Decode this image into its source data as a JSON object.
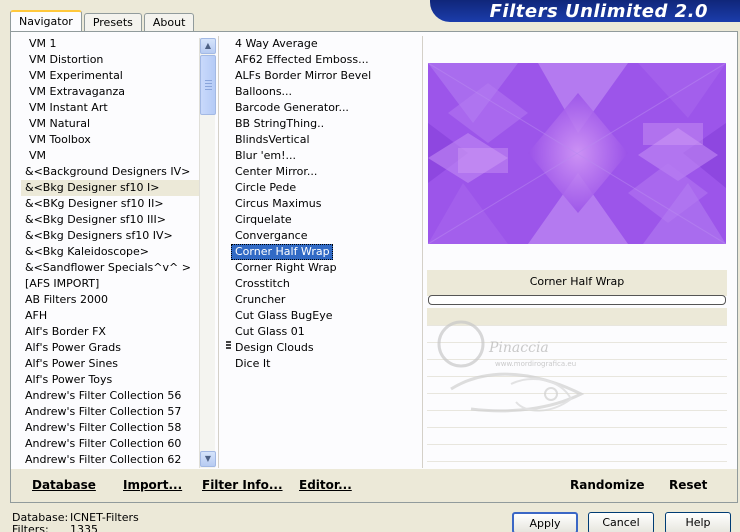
{
  "tabs": [
    "Navigator",
    "Presets",
    "About"
  ],
  "app_title": "Filters Unlimited 2.0",
  "categories": [
    "VM 1",
    "VM Distortion",
    "VM Experimental",
    "VM Extravaganza",
    "VM Instant Art",
    "VM Natural",
    "VM Toolbox",
    "VM",
    "&<Background Designers IV>",
    "&<Bkg Designer sf10 I>",
    "&<BKg Designer sf10 II>",
    "&<Bkg Designer sf10 III>",
    "&<Bkg Designers sf10 IV>",
    "&<Bkg Kaleidoscope>",
    "&<Sandflower Specials^v^ >",
    "[AFS IMPORT]",
    "AB Filters 2000",
    "AFH",
    "Alf's Border FX",
    "Alf's Power Grads",
    "Alf's Power Sines",
    "Alf's Power Toys",
    "Andrew's Filter Collection 56",
    "Andrew's Filter Collection 57",
    "Andrew's Filter Collection 58",
    "Andrew's Filter Collection 60",
    "Andrew's Filter Collection 62"
  ],
  "selected_category": "&<Bkg Designer sf10 I>",
  "filters": [
    "4 Way Average",
    "AF62 Effected Emboss...",
    "ALFs Border Mirror Bevel",
    "Balloons...",
    "Barcode Generator...",
    "BB StringThing..",
    "BlindsVertical",
    "Blur 'em!...",
    "Center Mirror...",
    "Circle Pede",
    "Circus Maximus",
    "Cirquelate",
    "Convergance",
    "Corner Half Wrap",
    "Corner Right Wrap",
    "Crosstitch",
    "Cruncher",
    "Cut Glass  BugEye",
    "Cut Glass 01",
    "Design Clouds",
    "Dice It"
  ],
  "selected_filter": "Corner Half Wrap",
  "preview_filter_name": "Corner Half Wrap",
  "watermark": {
    "text": "Pinaccia",
    "subtext": "www.mordirografica.eu"
  },
  "bottom_buttons": {
    "database": "Database",
    "import": "Import...",
    "filter_info": "Filter Info...",
    "editor": "Editor...",
    "randomize": "Randomize",
    "reset": "Reset"
  },
  "status": {
    "database_label": "Database:",
    "database_value": "ICNET-Filters",
    "filters_label": "Filters:",
    "filters_value": "1335"
  },
  "dialog_buttons": {
    "apply": "Apply",
    "cancel": "Cancel",
    "help": "Help"
  },
  "colors": {
    "selection": "#316ac5",
    "banner": "#10267a",
    "preview_purple": "#9a52e8"
  }
}
